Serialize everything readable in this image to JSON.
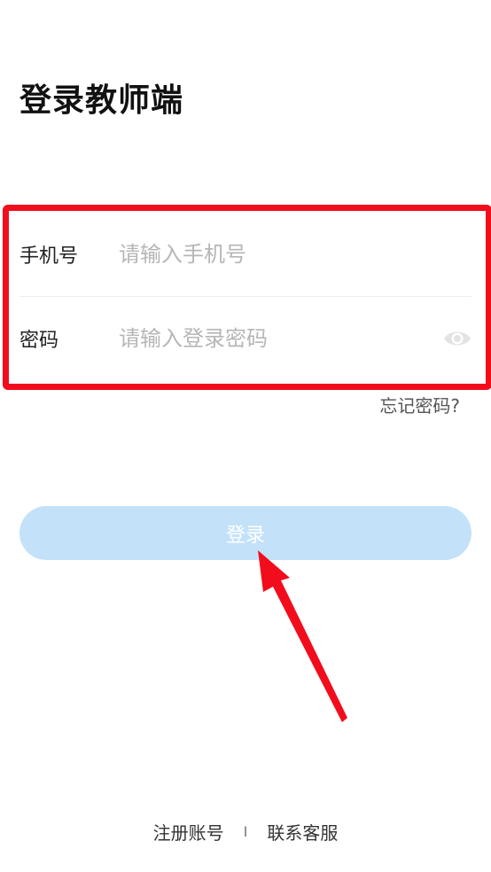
{
  "title": "登录教师端",
  "form": {
    "phone_label": "手机号",
    "phone_placeholder": "请输入手机号",
    "phone_value": "",
    "password_label": "密码",
    "password_placeholder": "请输入登录密码",
    "password_value": ""
  },
  "forgot_label": "忘记密码?",
  "login_label": "登录",
  "footer": {
    "register_label": "注册账号",
    "separator": "I",
    "support_label": "联系客服"
  },
  "icons": {
    "password_toggle": "eye-icon"
  },
  "colors": {
    "highlight": "#f20d1c",
    "login_button_bg": "#c3e2fa",
    "arrow": "#f20d1c",
    "placeholder": "#b6b6b6"
  }
}
